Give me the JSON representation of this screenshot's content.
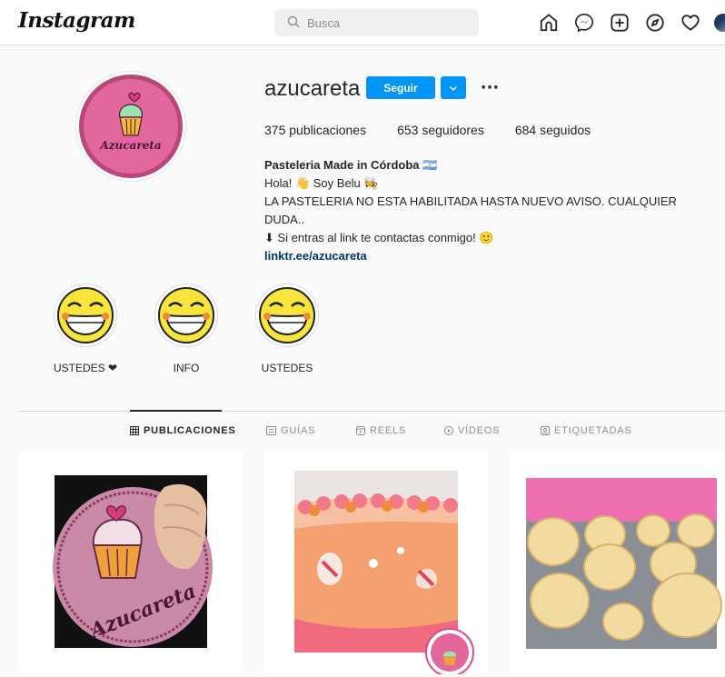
{
  "app": {
    "logo": "Instagram"
  },
  "search": {
    "placeholder": "Busca"
  },
  "nav": {
    "icons": [
      "home-icon",
      "messenger-icon",
      "new-post-icon",
      "explore-icon",
      "activity-heart-icon",
      "profile-avatar"
    ]
  },
  "profile": {
    "username": "azucareta",
    "pic_text": "Azucareta",
    "follow_label": "Seguir",
    "more_label": "···",
    "stats": {
      "posts_count": "375",
      "posts_label": "publicaciones",
      "followers_count": "653",
      "followers_label": "seguidores",
      "following_count": "684",
      "following_label": "seguidos"
    },
    "bio": {
      "name": "Pasteleria Made in Córdoba 🇦🇷",
      "line1": "Hola! 👋 Soy Belu 👩‍🍳",
      "line2": "LA PASTELERIA NO ESTA HABILITADA HASTA NUEVO AVISO. CUALQUIER DUDA..",
      "line3": "⬇ Si entras al link te contactas conmigo! 🙂",
      "link": "linktr.ee/azucareta"
    }
  },
  "highlights": [
    {
      "label": "USTEDES ❤"
    },
    {
      "label": "INFO"
    },
    {
      "label": "USTEDES"
    }
  ],
  "tabs": [
    {
      "label": "PUBLICACIONES",
      "active": true
    },
    {
      "label": "GUÍAS",
      "active": false
    },
    {
      "label": "REELS",
      "active": false
    },
    {
      "label": "VÍDEOS",
      "active": false
    },
    {
      "label": "ETIQUETADAS",
      "active": false
    }
  ],
  "colors": {
    "accent": "#0095f6",
    "brand_pink": "#e2679d",
    "link": "#00376b"
  }
}
